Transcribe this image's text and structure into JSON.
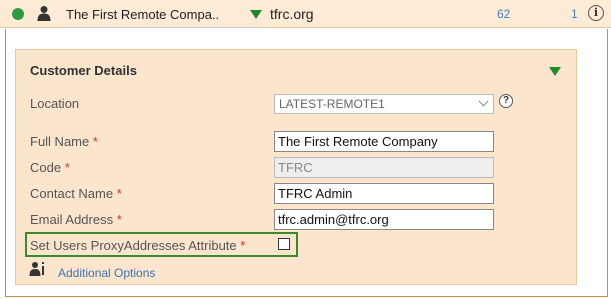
{
  "header": {
    "entity_name": "The First Remote Compa..",
    "domain": "tfrc.org",
    "count": "62",
    "secondary_count": "1",
    "info_glyph": "i",
    "status_color": "#2f9a3f"
  },
  "panel": {
    "title": "Customer Details",
    "fields": {
      "location": {
        "label": "Location",
        "value": "LATEST-REMOTE1",
        "help_glyph": "?"
      },
      "full_name": {
        "label": "Full Name",
        "required": "*",
        "value": "The First Remote Company"
      },
      "code": {
        "label": "Code",
        "required": "*",
        "value": "TFRC"
      },
      "contact_name": {
        "label": "Contact Name",
        "required": "*",
        "value": "TFRC Admin"
      },
      "email_address": {
        "label": "Email Address",
        "required": "*",
        "value": "tfrc.admin@tfrc.org"
      },
      "proxy_addresses": {
        "label": "Set Users ProxyAddresses Attribute",
        "required": "*",
        "checked": false
      }
    },
    "additional_options": "Additional Options"
  },
  "colors": {
    "accent_green": "#1e8a2c",
    "highlight_border": "#3d8a2e",
    "panel_bg": "#fbe5cc",
    "link": "#3d74b5",
    "required": "#d6312b"
  }
}
